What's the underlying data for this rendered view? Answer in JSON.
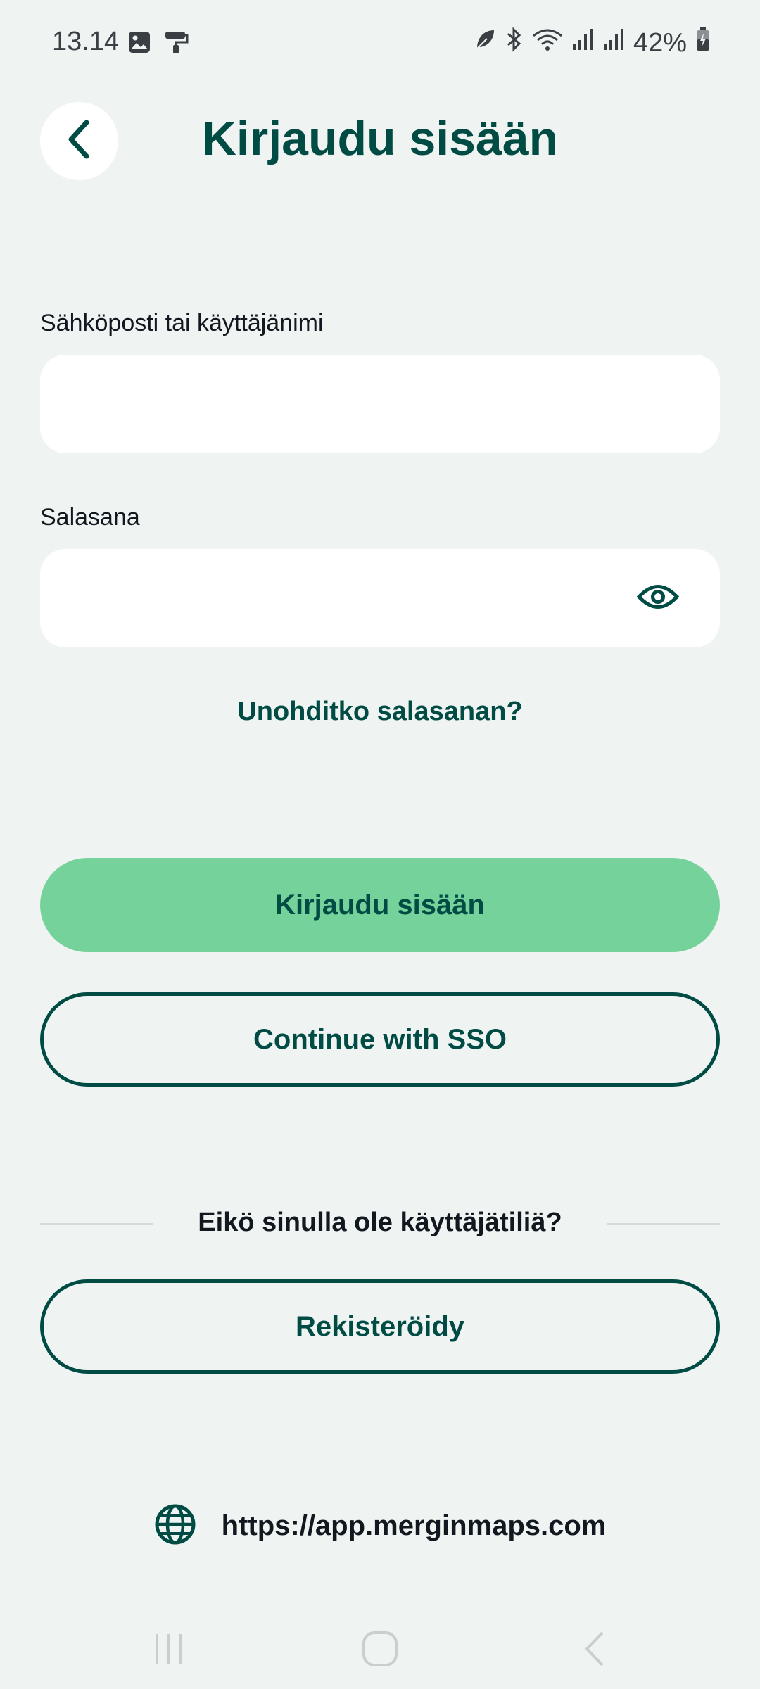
{
  "status_bar": {
    "time": "13.14",
    "battery": "42%",
    "left_icons": [
      "image-icon",
      "paint-roller-icon"
    ],
    "right_icons": [
      "leaf-icon",
      "bluetooth-icon",
      "wifi-icon",
      "signal-icon",
      "signal-icon",
      "battery-charging-icon"
    ]
  },
  "header": {
    "title": "Kirjaudu sisään",
    "back_icon": "chevron-left-icon"
  },
  "form": {
    "username_label": "Sähköposti tai käyttäjänimi",
    "username_value": "",
    "password_label": "Salasana",
    "password_value": "",
    "forgot_password": "Unohditko salasanan?"
  },
  "actions": {
    "sign_in": "Kirjaudu sisään",
    "sso": "Continue with SSO",
    "no_account": "Eikö sinulla ole käyttäjätiliä?",
    "register": "Rekisteröidy"
  },
  "server": {
    "url": "https://app.merginmaps.com",
    "icon": "globe-icon"
  },
  "colors": {
    "background": "#eff4f2",
    "brand_dark": "#004c45",
    "primary_button": "#76d29b",
    "field_background": "#ffffff"
  }
}
